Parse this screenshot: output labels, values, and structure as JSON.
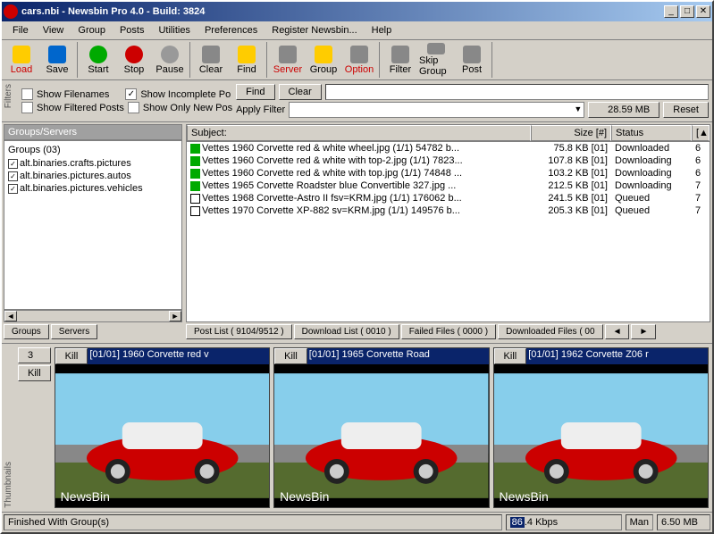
{
  "titlebar": {
    "text": "cars.nbi - Newsbin Pro 4.0 - Build: 3824"
  },
  "menu": [
    "File",
    "View",
    "Group",
    "Posts",
    "Utilities",
    "Preferences",
    "Register Newsbin...",
    "Help"
  ],
  "toolbar": [
    {
      "label": "Load",
      "color": "red",
      "icon": "yellow"
    },
    {
      "label": "Save",
      "color": "",
      "icon": "blue"
    },
    {
      "label": "Start",
      "color": "",
      "icon": "green"
    },
    {
      "label": "Stop",
      "color": "",
      "icon": "red"
    },
    {
      "label": "Pause",
      "color": "",
      "icon": "gray"
    },
    {
      "label": "Clear",
      "color": "",
      "icon": ""
    },
    {
      "label": "Find",
      "color": "",
      "icon": "yellow"
    },
    {
      "label": "Server",
      "color": "red",
      "icon": ""
    },
    {
      "label": "Group",
      "color": "",
      "icon": "yellow"
    },
    {
      "label": "Option",
      "color": "red",
      "icon": ""
    },
    {
      "label": "Filter",
      "color": "",
      "icon": ""
    },
    {
      "label": "Skip Group",
      "color": "",
      "icon": ""
    },
    {
      "label": "Post",
      "color": "",
      "icon": ""
    }
  ],
  "filter": {
    "show_filenames": "Show Filenames",
    "show_incomplete": "Show Incomplete Po",
    "show_filtered": "Show Filtered Posts",
    "show_only_new": "Show Only New Pos",
    "find_btn": "Find",
    "clear_btn": "Clear",
    "apply_label": "Apply Filter",
    "mb_btn": "28.59 MB",
    "reset_btn": "Reset"
  },
  "sidebar_labels": {
    "filters": "Filters",
    "thumbnails": "Thumbnails"
  },
  "groups_panel": {
    "header": "Groups/Servers",
    "count": "Groups (03)",
    "items": [
      "alt.binaries.crafts.pictures",
      "alt.binaries.pictures.autos",
      "alt.binaries.pictures.vehicles"
    ],
    "tabs": [
      "Groups",
      "Servers"
    ]
  },
  "listview": {
    "headers": {
      "subject": "Subject:",
      "size": "Size [#]",
      "status": "Status",
      "last": "[▲"
    },
    "rows": [
      {
        "icon": "green",
        "subject": "Vettes 1960 Corvette red & white wheel.jpg (1/1) 54782 b...",
        "size": "75.8 KB [01]",
        "status": "Downloaded",
        "last": "6"
      },
      {
        "icon": "green",
        "subject": "Vettes 1960 Corvette red & white with top-2.jpg (1/1) 7823...",
        "size": "107.8 KB [01]",
        "status": "Downloading",
        "last": "6"
      },
      {
        "icon": "green",
        "subject": "Vettes 1960 Corvette red & white with top.jpg (1/1) 74848 ...",
        "size": "103.2 KB [01]",
        "status": "Downloading",
        "last": "6"
      },
      {
        "icon": "green",
        "subject": "Vettes 1965 Corvette Roadster blue Convertible 327.jpg ...",
        "size": "212.5 KB [01]",
        "status": "Downloading",
        "last": "7"
      },
      {
        "icon": "white",
        "subject": "Vettes 1968 Corvette-Astro II fsv=KRM.jpg (1/1) 176062 b...",
        "size": "241.5 KB [01]",
        "status": "Queued",
        "last": "7"
      },
      {
        "icon": "white",
        "subject": "Vettes 1970 Corvette XP-882 sv=KRM.jpg (1/1) 149576 b...",
        "size": "205.3 KB [01]",
        "status": "Queued",
        "last": "7"
      }
    ]
  },
  "post_tabs": [
    "Post List ( 9104/9512 )",
    "Download List ( 0010 )",
    "Failed Files ( 0000 )",
    "Downloaded Files ( 00"
  ],
  "thumbnails": {
    "count": "3",
    "kill": "Kill",
    "items": [
      {
        "title": "[01/01] 1960 Corvette red v"
      },
      {
        "title": "[01/01] 1965 Corvette Road"
      },
      {
        "title": "[01/01] 1962 Corvette Z06 r"
      }
    ],
    "watermark": "NewsBin"
  },
  "statusbar": {
    "text": "Finished With Group(s)",
    "kbps_num": "86",
    "kbps_rest": ".4 Kbps",
    "man": "Man",
    "mb": "6.50 MB"
  }
}
